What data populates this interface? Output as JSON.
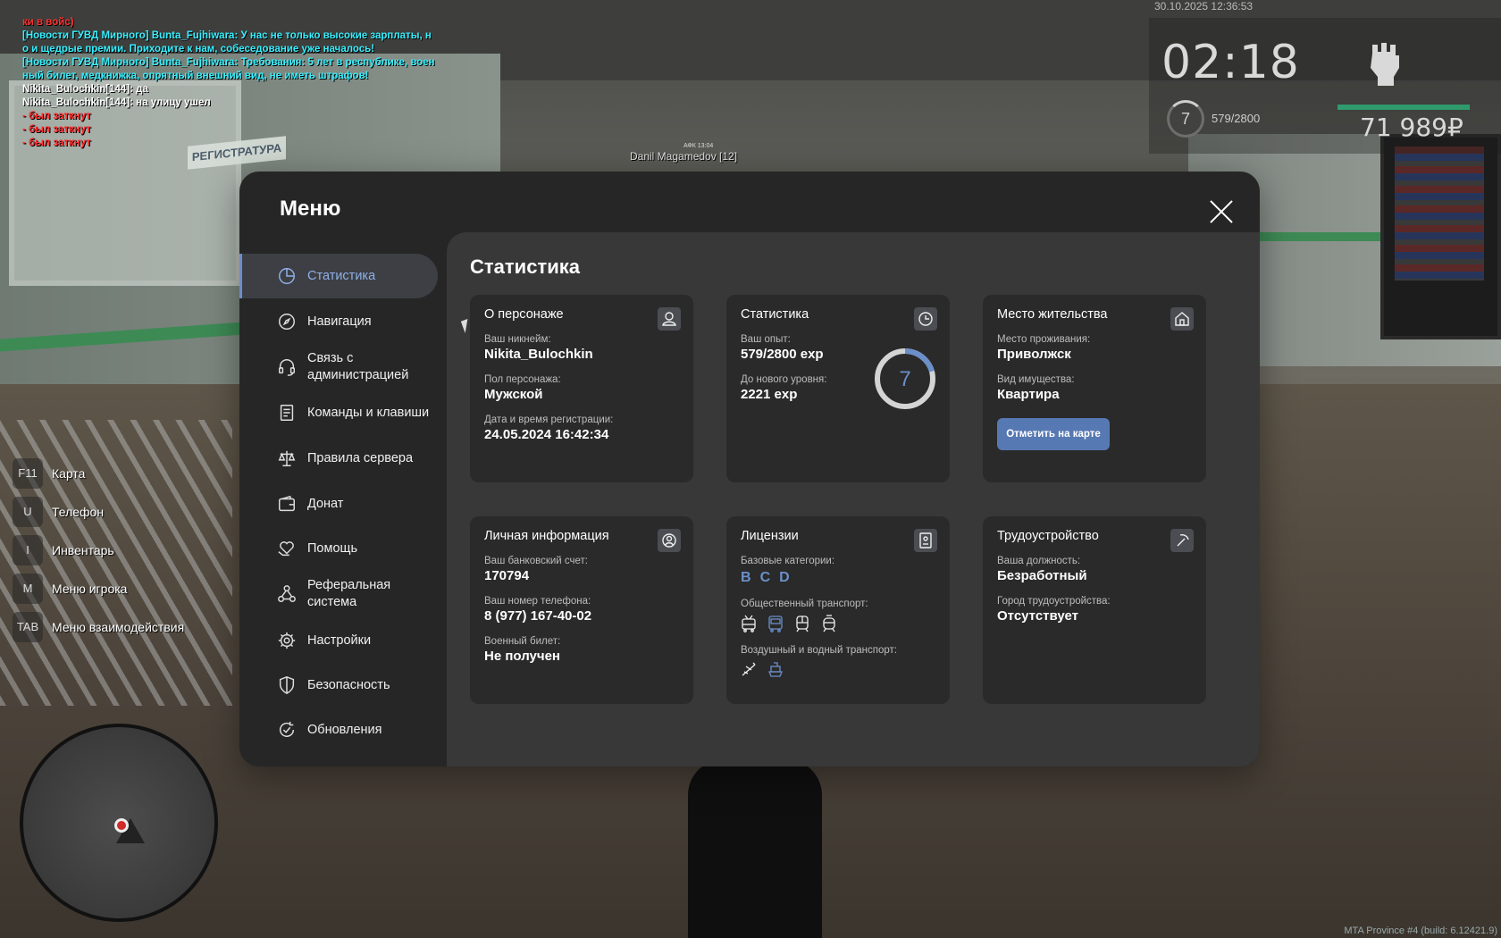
{
  "chat": [
    {
      "text": "ки в войс)",
      "color": "#ff3030"
    },
    {
      "text": "[Новости ГУВД Мирного] Bunta_Fujhiwara: У нас не только высокие зарплаты, н",
      "color": "#37f0ff"
    },
    {
      "text": "о и щедрые премии. Приходите к нам, собеседование уже началось!",
      "color": "#37f0ff"
    },
    {
      "text": "[Новости ГУВД Мирного] Bunta_Fujhiwara: Требования: 5 лет в республике, воен",
      "color": "#37f0ff"
    },
    {
      "text": "ный билет, медкнижка, опрятный внешний вид, не иметь штрафов!",
      "color": "#37f0ff"
    },
    {
      "text": "Nikita_Bulochkin[144]: да",
      "color": "#ffffff"
    },
    {
      "text": "Nikita_Bulochkin[144]: на улицу ушел",
      "color": "#ffffff"
    },
    {
      "text": "- был заткнут",
      "color": "#ff3030"
    },
    {
      "text": "- был заткнут",
      "color": "#ff3030"
    },
    {
      "text": "- был заткнут",
      "color": "#ff3030"
    }
  ],
  "hud": {
    "date": "30.10.2025 12:36:53",
    "time": "02:18",
    "level": "7",
    "exp": "579/2800",
    "money": "71 989₽"
  },
  "world": {
    "sign": "РЕГИСТРАТУРА",
    "nametag": "Danil Magamedov [12]",
    "nametag_top": "АФК 13:04"
  },
  "keys": [
    {
      "key": "F11",
      "label": "Карта"
    },
    {
      "key": "U",
      "label": "Телефон"
    },
    {
      "key": "I",
      "label": "Инвентарь"
    },
    {
      "key": "M",
      "label": "Меню игрока"
    },
    {
      "key": "TAB",
      "label": "Меню взаимодействия"
    }
  ],
  "watermark": "MTA Province #4 (build: 6.12421.9)",
  "menu": {
    "title": "Меню",
    "nav": [
      {
        "label": "Статистика",
        "icon": "pie-chart-icon",
        "active": true
      },
      {
        "label": "Навигация",
        "icon": "compass-icon"
      },
      {
        "label": "Связь с администрацией",
        "icon": "headset-icon"
      },
      {
        "label": "Команды и клавиши",
        "icon": "document-list-icon"
      },
      {
        "label": "Правила сервера",
        "icon": "scales-icon"
      },
      {
        "label": "Донат",
        "icon": "wallet-icon"
      },
      {
        "label": "Помощь",
        "icon": "heart-hand-icon"
      },
      {
        "label": "Реферальная система",
        "icon": "network-icon"
      },
      {
        "label": "Настройки",
        "icon": "gear-icon"
      },
      {
        "label": "Безопасность",
        "icon": "shield-icon"
      },
      {
        "label": "Обновления",
        "icon": "refresh-check-icon"
      }
    ],
    "section_title": "Статистика",
    "accent": "#6b8fc9",
    "cards": {
      "character": {
        "title": "О персонаже",
        "nick_label": "Ваш никнейм:",
        "nick": "Nikita_Bulochkin",
        "gender_label": "Пол персонажа:",
        "gender": "Мужской",
        "reg_label": "Дата и время регистрации:",
        "reg": "24.05.2024 16:42:34"
      },
      "stats": {
        "title": "Статистика",
        "exp_label": "Ваш опыт:",
        "exp": "579/2800 exp",
        "next_label": "До нового уровня:",
        "next": "2221 exp",
        "level": "7",
        "progress": 0.207
      },
      "residence": {
        "title": "Место жительства",
        "place_label": "Место проживания:",
        "place": "Приволжск",
        "type_label": "Вид имущества:",
        "type": "Квартира",
        "button": "Отметить на карте"
      },
      "personal": {
        "title": "Личная информация",
        "bank_label": "Ваш банковский счет:",
        "bank": "170794",
        "phone_label": "Ваш номер телефона:",
        "phone": "8 (977) 167-40-02",
        "military_label": "Военный билет:",
        "military": "Не получен"
      },
      "licenses": {
        "title": "Лицензии",
        "base_label": "Базовые категории:",
        "base": [
          "B",
          "C",
          "D"
        ],
        "public_label": "Общественный транспорт:",
        "air_label": "Воздушный и водный транспорт:"
      },
      "job": {
        "title": "Трудоустройство",
        "pos_label": "Ваша должность:",
        "pos": "Безработный",
        "city_label": "Город трудоустройства:",
        "city": "Отсутствует"
      }
    }
  }
}
